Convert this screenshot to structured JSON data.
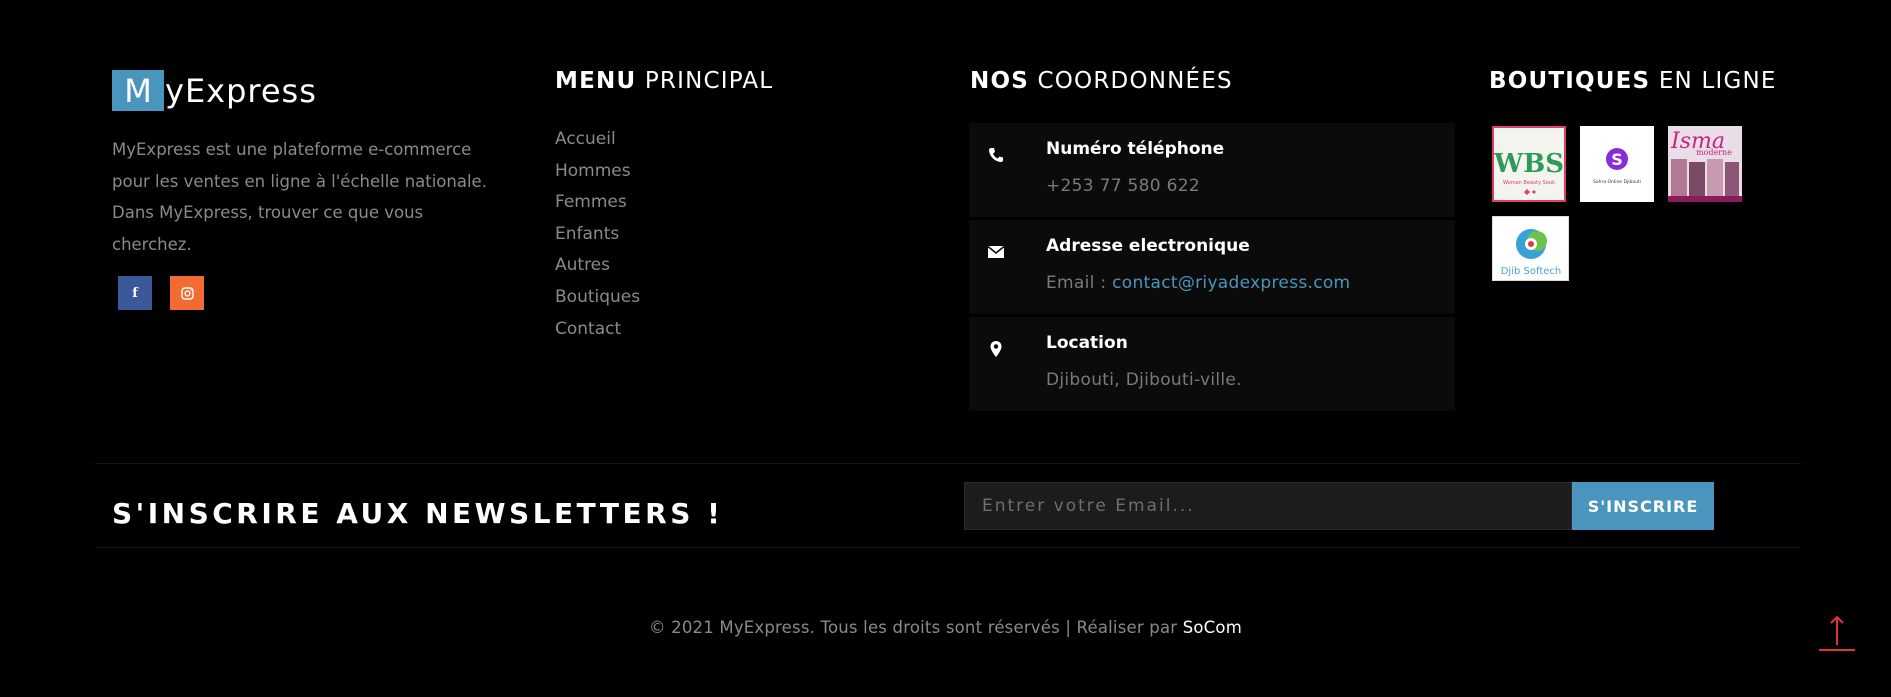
{
  "about": {
    "logo_initial": "M",
    "logo_rest": "yExpress",
    "description": "MyExpress est une plateforme e-commerce pour les ventes en ligne à l'échelle nationale. Dans MyExpress, trouver ce que vous cherchez.",
    "social": [
      {
        "name": "facebook-icon",
        "glyph": "f"
      },
      {
        "name": "instagram-icon",
        "glyph": "◎"
      }
    ]
  },
  "menu": {
    "heading_bold": "MENU",
    "heading_light": "PRINCIPAL",
    "items": [
      "Accueil",
      "Hommes",
      "Femmes",
      "Enfants",
      "Autres",
      "Boutiques",
      "Contact"
    ]
  },
  "contacts": {
    "heading_bold": "NOS",
    "heading_light": "COORDONNÉES",
    "phone": {
      "title": "Numéro téléphone",
      "value": "+253 77 580 622",
      "icon": "phone-icon"
    },
    "email": {
      "title": "Adresse electronique",
      "prefix": "Email : ",
      "value": "contact@riyadexpress.com",
      "icon": "envelope-icon"
    },
    "location": {
      "title": "Location",
      "value": "Djibouti, Djibouti-ville.",
      "icon": "map-marker-icon"
    }
  },
  "boutiques": {
    "heading_bold": "BOUTIQUES",
    "heading_light": "EN LIGNE",
    "shops": [
      {
        "name": "WBS",
        "subtitle": "Woman Beauty Souk"
      },
      {
        "name": "S",
        "subtitle": "Sahra Online Djibouti"
      },
      {
        "name": "Isma",
        "subtitle": "moderne"
      },
      {
        "name": "Djib Softech",
        "subtitle": ""
      }
    ]
  },
  "newsletter": {
    "title": "S'INSCRIRE AUX NEWSLETTERS !",
    "placeholder": "Entrer votre Email...",
    "button": "S'INSCRIRE"
  },
  "footer": {
    "text": "© 2021 MyExpress. Tous les droits sont réservés | Réaliser par ",
    "brand": "SoCom"
  },
  "colors": {
    "accent": "#4a95bd",
    "facebook": "#3b5998",
    "instagram": "#f26b35",
    "to_top": "#e0343b"
  }
}
